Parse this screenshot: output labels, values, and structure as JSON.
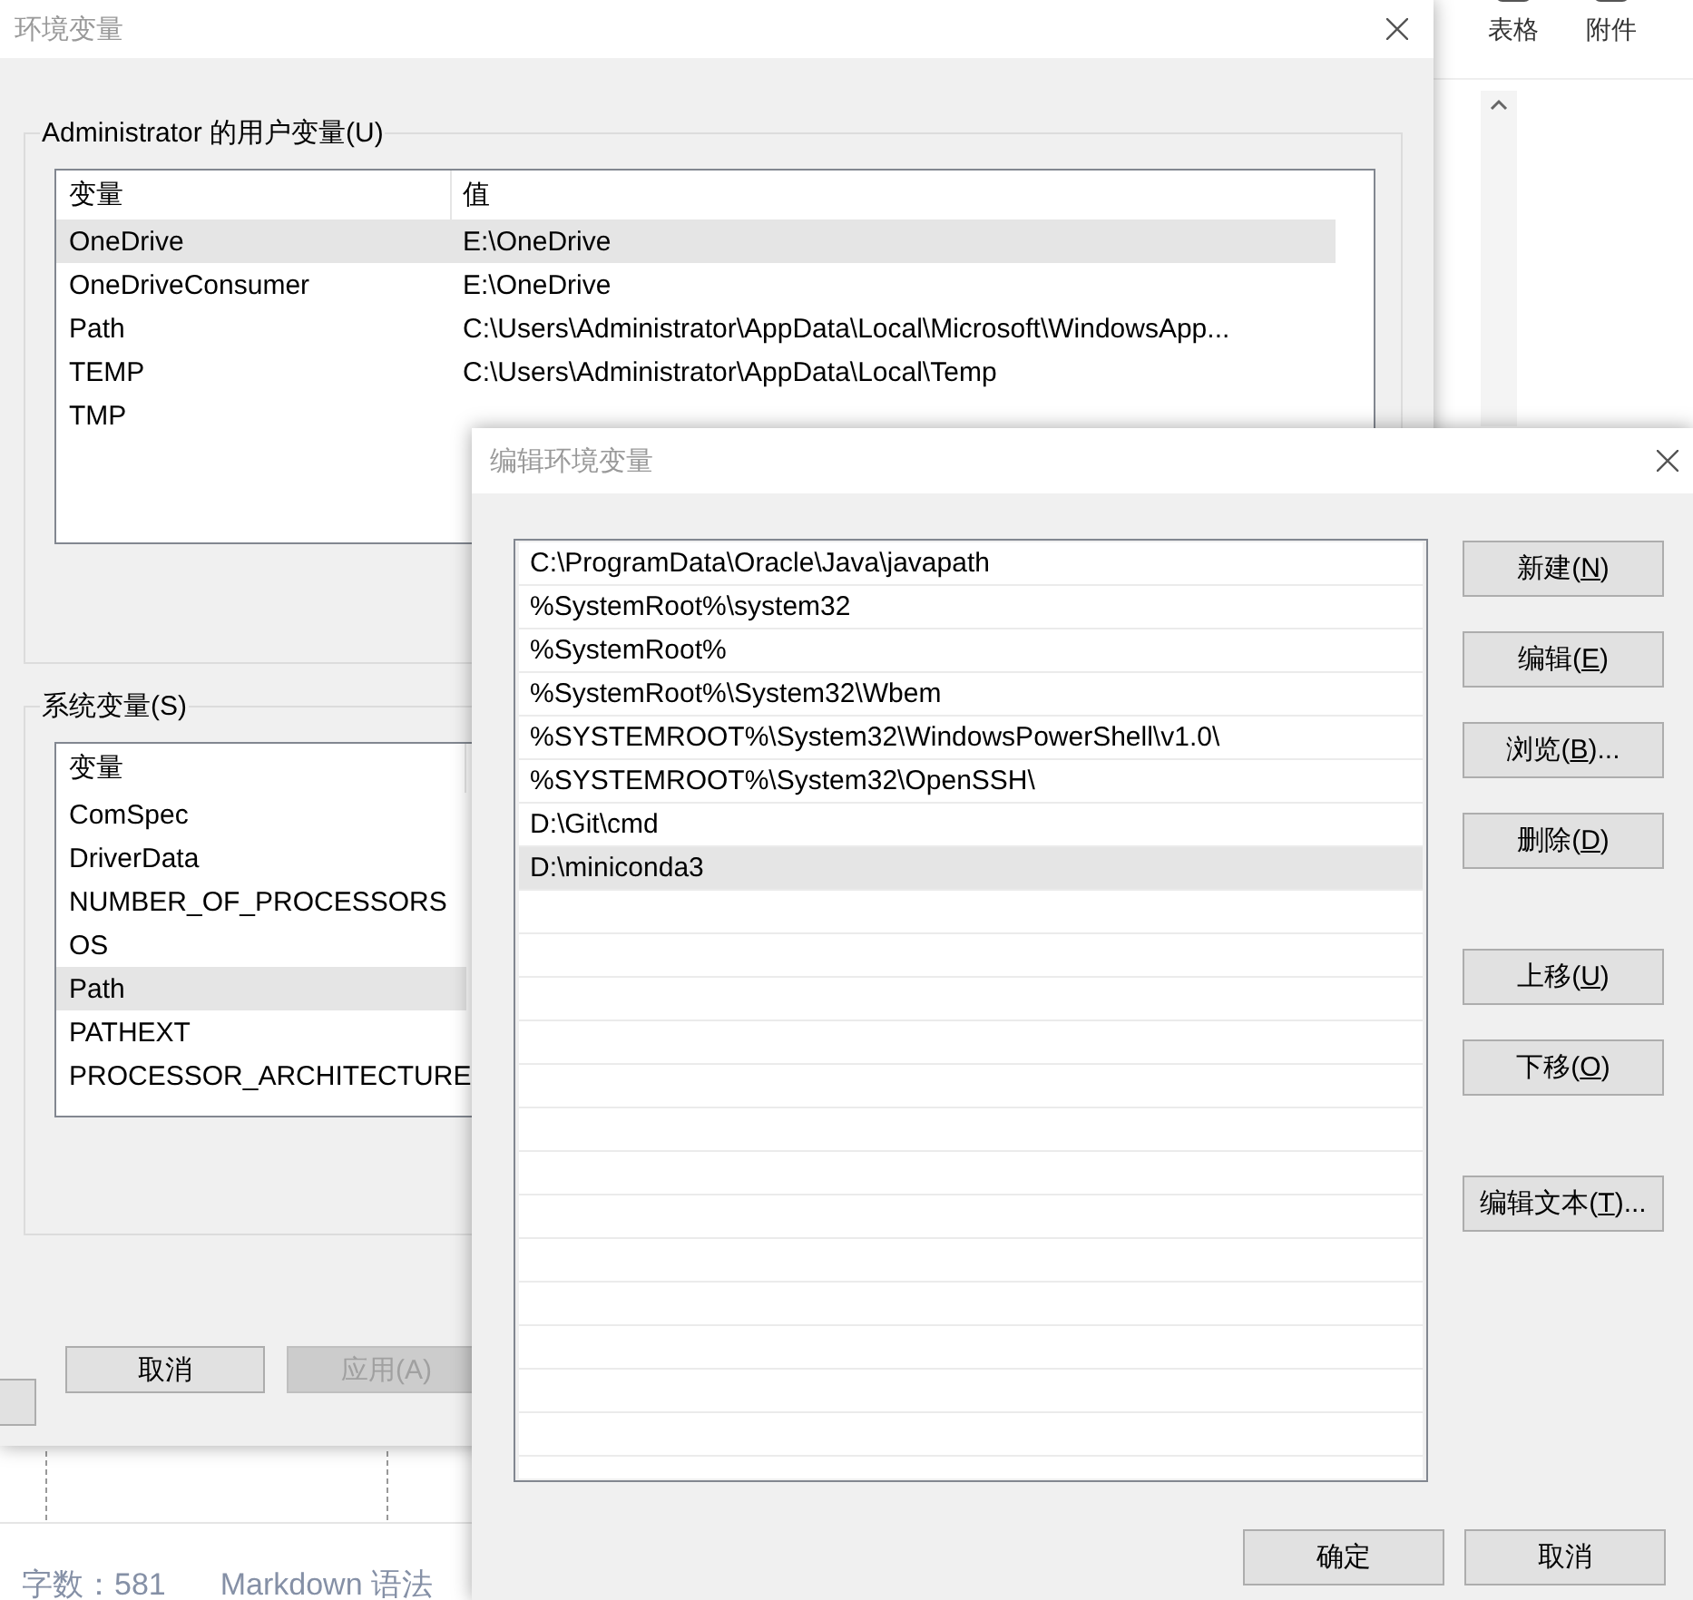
{
  "background_app": {
    "toolbar": [
      {
        "label": "表格"
      },
      {
        "label": "附件"
      }
    ],
    "status_bar": {
      "word_count": "字数：581",
      "syntax": "Markdown 语法"
    }
  },
  "env_dialog": {
    "title": "环境变量",
    "user_group": {
      "title": "Administrator 的用户变量(U)",
      "columns": [
        "变量",
        "值"
      ],
      "rows": [
        {
          "name": "OneDrive",
          "value": "E:\\OneDrive",
          "selected": true
        },
        {
          "name": "OneDriveConsumer",
          "value": "E:\\OneDrive",
          "selected": false
        },
        {
          "name": "Path",
          "value": "C:\\Users\\Administrator\\AppData\\Local\\Microsoft\\WindowsApp...",
          "selected": false
        },
        {
          "name": "TEMP",
          "value": "C:\\Users\\Administrator\\AppData\\Local\\Temp",
          "selected": false
        },
        {
          "name": "TMP",
          "selected": false
        }
      ]
    },
    "system_group": {
      "title": "系统变量(S)",
      "columns": [
        "变量"
      ],
      "rows": [
        {
          "name": "ComSpec",
          "selected": false
        },
        {
          "name": "DriverData",
          "selected": false
        },
        {
          "name": "NUMBER_OF_PROCESSORS",
          "selected": false
        },
        {
          "name": "OS",
          "selected": false
        },
        {
          "name": "Path",
          "selected": true
        },
        {
          "name": "PATHEXT",
          "selected": false
        },
        {
          "name": "PROCESSOR_ARCHITECTURE",
          "selected": false
        }
      ]
    },
    "buttons": [
      {
        "label": "取消",
        "disabled": false
      },
      {
        "label": "应用(A)",
        "disabled": true
      }
    ]
  },
  "edit_dialog": {
    "title": "编辑环境变量",
    "entries": [
      {
        "text": "C:\\ProgramData\\Oracle\\Java\\javapath",
        "selected": false
      },
      {
        "text": "%SystemRoot%\\system32",
        "selected": false
      },
      {
        "text": "%SystemRoot%",
        "selected": false
      },
      {
        "text": "%SystemRoot%\\System32\\Wbem",
        "selected": false
      },
      {
        "text": "%SYSTEMROOT%\\System32\\WindowsPowerShell\\v1.0\\",
        "selected": false
      },
      {
        "text": "%SYSTEMROOT%\\System32\\OpenSSH\\",
        "selected": false
      },
      {
        "text": "D:\\Git\\cmd",
        "selected": false
      },
      {
        "text": "D:\\miniconda3",
        "selected": true
      }
    ],
    "button_groups": [
      [
        {
          "before": "新建(",
          "mnemonic": "N",
          "after": ")"
        },
        {
          "before": "编辑(",
          "mnemonic": "E",
          "after": ")"
        },
        {
          "before": "浏览(",
          "mnemonic": "B",
          "after": ")..."
        },
        {
          "before": "删除(",
          "mnemonic": "D",
          "after": ")"
        }
      ],
      [
        {
          "before": "上移(",
          "mnemonic": "U",
          "after": ")"
        },
        {
          "before": "下移(",
          "mnemonic": "O",
          "after": ")"
        }
      ],
      [
        {
          "before": "编辑文本(",
          "mnemonic": "T",
          "after": ")..."
        }
      ]
    ],
    "footer_buttons": [
      {
        "label": "确定"
      },
      {
        "label": "取消"
      }
    ]
  }
}
